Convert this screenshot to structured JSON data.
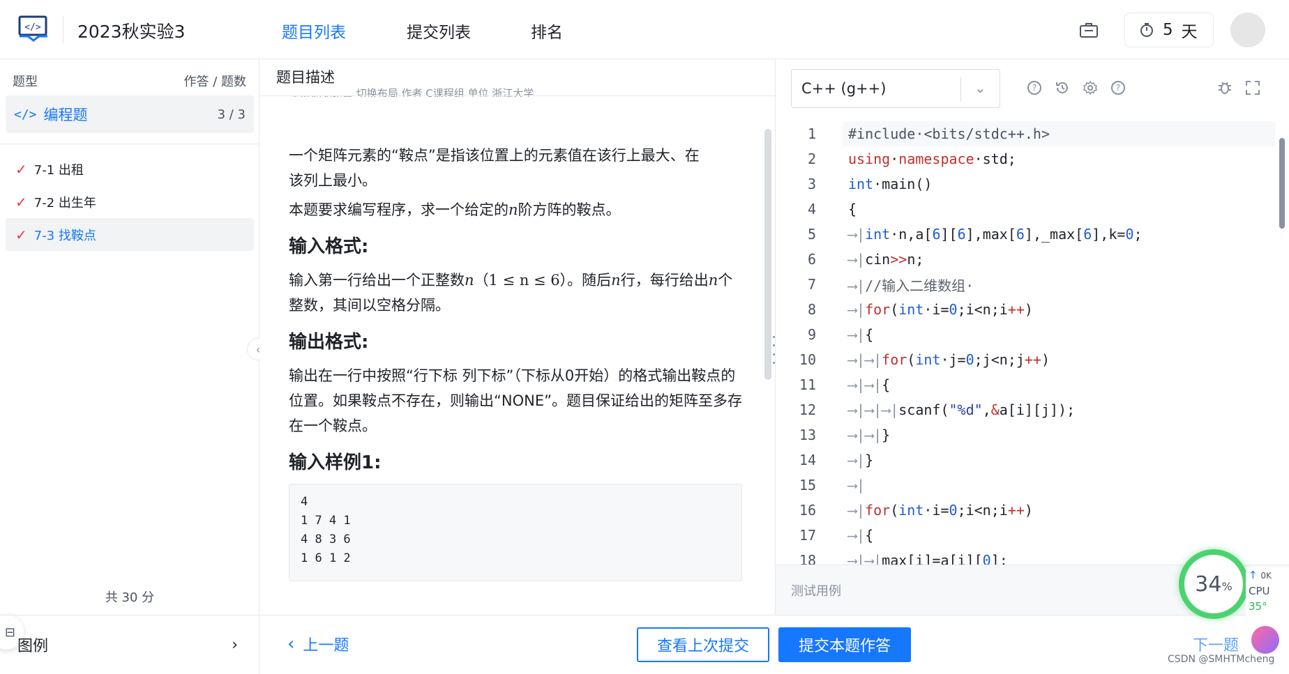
{
  "header": {
    "title": "2023秋实验3",
    "tabs": [
      {
        "label": "题目列表",
        "active": true
      },
      {
        "label": "提交列表",
        "active": false
      },
      {
        "label": "排名",
        "active": false
      }
    ],
    "timer_value": "5",
    "timer_unit": "天",
    "accent": "#1677ff"
  },
  "sidebar": {
    "col_type": "题型",
    "col_count": "作答 / 题数",
    "category": {
      "label": "编程题",
      "count": "3 / 3"
    },
    "problems": [
      {
        "label": "7-1 出租",
        "done": true
      },
      {
        "label": "7-2 出生年",
        "done": true
      },
      {
        "label": "7-3 找鞍点",
        "done": true
      }
    ],
    "total": "共 30 分",
    "legend": "图例"
  },
  "problem": {
    "tab": "题目描述",
    "meta_cut": "上屏浏览题目  切换布局                        作者 C课程组    单位 浙江大学",
    "p1": "一个矩阵元素的“鞍点”是指该位置上的元素值在该行上最大、在该列上最小。",
    "p2a": "本题要求编写程序，求一个给定的",
    "p2var": "n",
    "p2b": "阶方阵的鞍点。",
    "h_input": "输入格式:",
    "in_a": "输入第一行给出一个正整数",
    "in_var": "n",
    "in_range": "（1 ≤ n ≤ 6）",
    "in_b": "。随后",
    "in_var2": "n",
    "in_c": "行，每行给出",
    "in_var3": "n",
    "in_d": "个整数，其间以空格分隔。",
    "h_output": "输出格式:",
    "out": "输出在一行中按照“行下标 列下标”（下标从0开始）的格式输出鞍点的位置。如果鞍点不存在，则输出“NONE”。题目保证给出的矩阵至多存在一个鞍点。",
    "h_sample": "输入样例1:",
    "sample": "4\n1 7 4 1\n4 8 3 6\n1 6 1 2"
  },
  "editor": {
    "language": "C++ (g++)",
    "test_label": "测试用例"
  },
  "footer": {
    "prev": "上一题",
    "view_last": "查看上次提交",
    "submit": "提交本题作答",
    "next": "下一题"
  },
  "overlay": {
    "percent": "34",
    "percent_unit": "%",
    "cpu_label": "CPU",
    "cpu_value": "35°",
    "net_speed": "0K",
    "watermark": "CSDN @SMHTMcheng"
  }
}
